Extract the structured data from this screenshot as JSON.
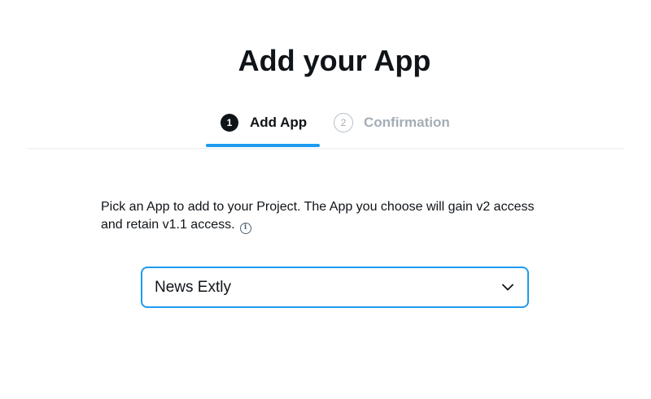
{
  "page": {
    "title": "Add your App"
  },
  "stepper": {
    "steps": [
      {
        "number": "1",
        "label": "Add App",
        "state": "active"
      },
      {
        "number": "2",
        "label": "Confirmation",
        "state": "inactive"
      }
    ]
  },
  "content": {
    "description_line1": "Pick an App to add to your Project. The App you choose will gain v2 access",
    "description_line2": "and retain v1.1 access.",
    "info_icon": "info-icon"
  },
  "app_select": {
    "selected_value": "News Extly",
    "icon": "chevron-down-icon"
  },
  "colors": {
    "accent": "#1d9bf0",
    "text_primary": "#0f1419",
    "text_muted": "#a4adb5"
  }
}
